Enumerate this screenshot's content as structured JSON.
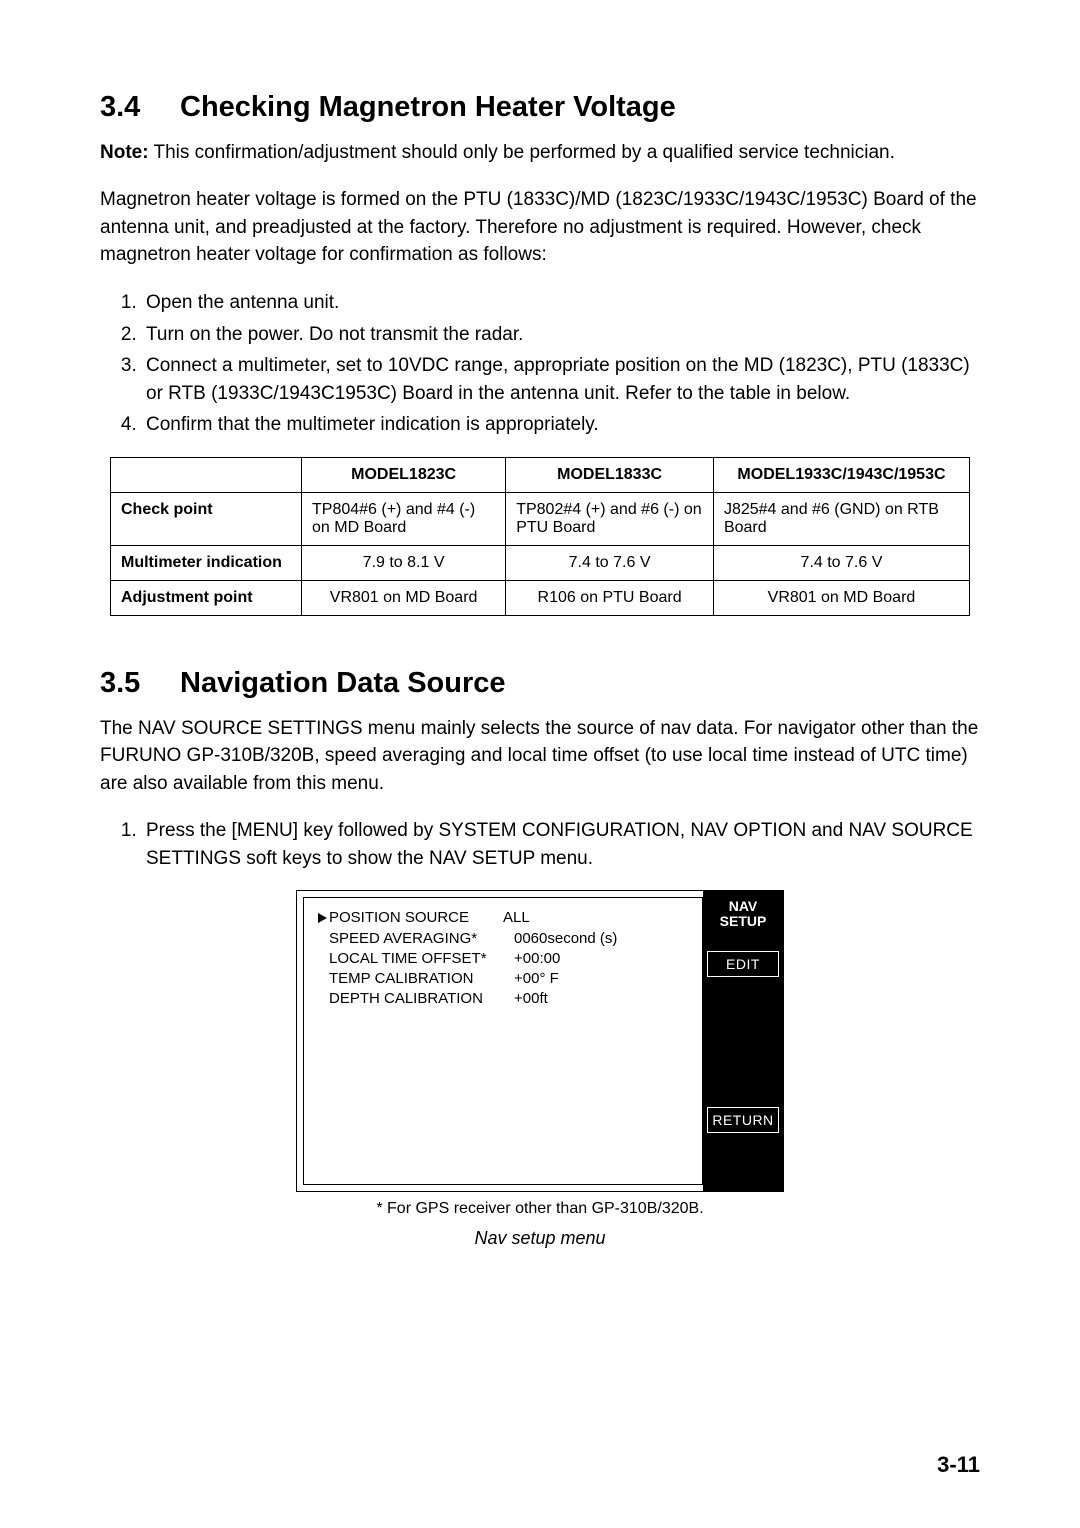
{
  "s34": {
    "num": "3.4",
    "title": "Checking Magnetron Heater Voltage",
    "note_label": "Note:",
    "note_body": "This confirmation/adjustment should only be performed by a qualified service technician.",
    "para": "Magnetron heater voltage is formed on the PTU (1833C)/MD (1823C/1933C/1943C/1953C) Board of the antenna unit, and preadjusted at the factory. Therefore no adjustment is required. However, check magnetron heater voltage for confirmation as follows:",
    "steps": [
      "Open the antenna unit.",
      "Turn on the power. Do not transmit the radar.",
      "Connect a multimeter, set to 10VDC range, appropriate position on the MD (1823C), PTU (1833C) or RTB (1933C/1943C1953C) Board in the antenna unit. Refer to the table in below.",
      "Confirm that the multimeter indication is appropriately."
    ],
    "table": {
      "headers": [
        "",
        "MODEL1823C",
        "MODEL1833C",
        "MODEL1933C/1943C/1953C"
      ],
      "rows": [
        {
          "label": "Check point",
          "c1": "TP804#6 (+) and #4 (-) on MD Board",
          "c2": "TP802#4 (+) and #6 (-) on PTU Board",
          "c3": "J825#4 and #6 (GND) on RTB Board"
        },
        {
          "label": "Multimeter indication",
          "c1": "7.9 to 8.1 V",
          "c2": "7.4 to 7.6 V",
          "c3": "7.4 to 7.6 V"
        },
        {
          "label": "Adjustment point",
          "c1": "VR801 on MD Board",
          "c2": "R106 on PTU Board",
          "c3": "VR801 on MD Board"
        }
      ]
    }
  },
  "s35": {
    "num": "3.5",
    "title": "Navigation Data Source",
    "para": "The NAV SOURCE SETTINGS menu mainly selects the source of nav data. For navigator other than the FURUNO GP-310B/320B, speed averaging and local time offset (to use local time instead of UTC time) are also available from this menu.",
    "steps": [
      "Press the [MENU] key followed by SYSTEM CONFIGURATION, NAV OPTION and NAV SOURCE SETTINGS soft keys to show the NAV SETUP menu."
    ],
    "menu": {
      "title_l1": "NAV",
      "title_l2": "SETUP",
      "softkey_edit": "EDIT",
      "softkey_return": "RETURN",
      "items": [
        {
          "label": "POSITION SOURCE",
          "value": "ALL",
          "selected": true
        },
        {
          "label": "SPEED AVERAGING*",
          "value": "0060second (s)"
        },
        {
          "label": "LOCAL TIME OFFSET*",
          "value": "+00:00"
        },
        {
          "label": "TEMP CALIBRATION",
          "value": "+00° F"
        },
        {
          "label": "DEPTH CALIBRATION",
          "value": "+00ft"
        }
      ]
    },
    "footnote": "* For GPS receiver other than GP-310B/320B.",
    "caption": "Nav setup menu"
  },
  "page_number": "3-11"
}
